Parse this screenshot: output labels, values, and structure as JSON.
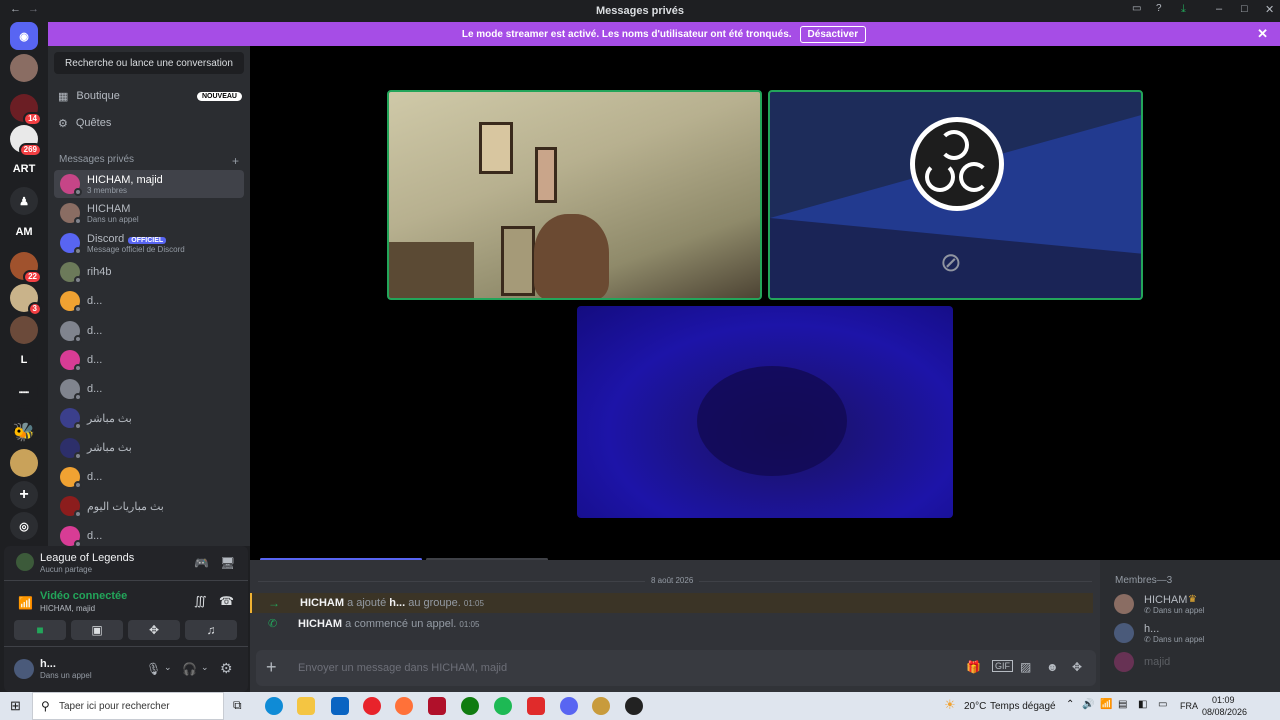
{
  "window": {
    "title": "Messages privés"
  },
  "banner": {
    "text": "Le mode streamer est activé. Les noms d'utilisateur ont été tronqués.",
    "button": "Désactiver"
  },
  "servers": {
    "labels": [
      "ART",
      "AM",
      "L"
    ],
    "badges": [
      "14",
      "269",
      "22",
      "3"
    ]
  },
  "dmpanel": {
    "search": "Recherche ou lance une conversation",
    "boutique": "Boutique",
    "nouveau": "NOUVEAU",
    "quetes": "Quêtes",
    "section": "Messages privés",
    "dms": [
      {
        "name": "HICHAM, majid",
        "sub": "3 membres",
        "color": "#c64587"
      },
      {
        "name": "HICHAM",
        "sub": "Dans un appel",
        "color": "#8a6d63"
      },
      {
        "name": "Discord",
        "sub": "Message officiel de Discord",
        "color": "#5865f2",
        "tag": "OFFICIEL"
      },
      {
        "name": "rih4b",
        "sub": "",
        "color": "#6c7a5a"
      },
      {
        "name": "d...",
        "sub": "",
        "color": "#f0a232"
      },
      {
        "name": "d...",
        "sub": "",
        "color": "#80848e"
      },
      {
        "name": "d...",
        "sub": "",
        "color": "#d83c95"
      },
      {
        "name": "d...",
        "sub": "",
        "color": "#80848e"
      },
      {
        "name": "بث مباشر",
        "sub": "",
        "color": "#3b3f8c"
      },
      {
        "name": "بث مباشر",
        "sub": "",
        "color": "#2d2f6a"
      },
      {
        "name": "d...",
        "sub": "",
        "color": "#f0a232"
      },
      {
        "name": "بث مباريات اليوم",
        "sub": "",
        "color": "#8c1d1d"
      },
      {
        "name": "d...",
        "sub": "",
        "color": "#d83c95"
      }
    ]
  },
  "userpanel": {
    "game": "League of Legends",
    "game_sub": "Aucun partage",
    "voice": "Vidéo connectée",
    "voice_sub": "HICHAM, majid",
    "user": "h...",
    "user_status": "Dans un appel"
  },
  "chat": {
    "date": "8 août 2026",
    "msg1": {
      "author": "HICHAM",
      "action": "a ajouté",
      "target": "h...",
      "rest": "au groupe.",
      "time": "01:05"
    },
    "msg2": {
      "author": "HICHAM",
      "action": "a commencé un appel.",
      "time": "01:05"
    },
    "placeholder": "Envoyer un message dans HICHAM, majid"
  },
  "members": {
    "header": "Membres—3",
    "list": [
      {
        "name": "HICHAM",
        "sub": "Dans un appel",
        "crown": true
      },
      {
        "name": "h...",
        "sub": "Dans un appel"
      },
      {
        "name": "majid",
        "sub": ""
      }
    ]
  },
  "taskbar": {
    "search": "Taper ici pour rechercher",
    "weather_temp": "20°C",
    "weather_text": "Temps dégagé",
    "lang": "FRA",
    "time": "01:09",
    "date": "08/08/2026"
  },
  "colors": {
    "accent": "#a64de6",
    "green": "#23a55a",
    "blurple": "#5865f2"
  }
}
